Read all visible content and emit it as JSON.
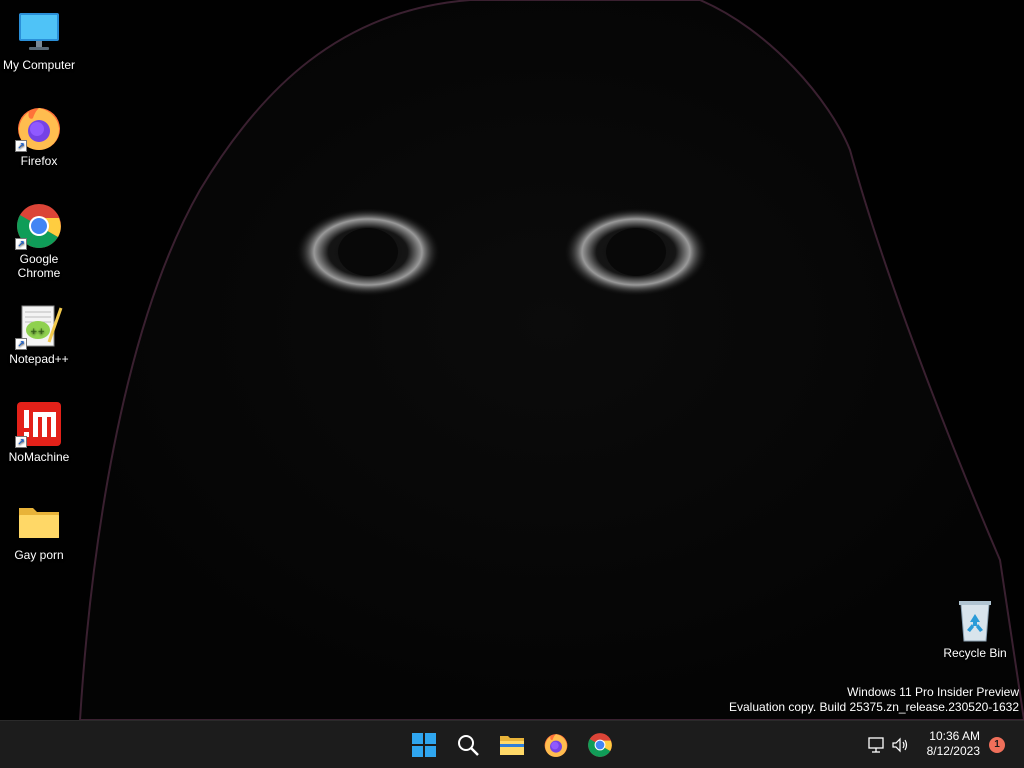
{
  "desktop": {
    "icons": [
      {
        "label": "My Computer",
        "icon": "monitor-icon"
      },
      {
        "label": "Firefox",
        "icon": "firefox-icon"
      },
      {
        "label": "Google Chrome",
        "icon": "chrome-icon"
      },
      {
        "label": "Notepad++",
        "icon": "notepad-plus-plus-icon"
      },
      {
        "label": "NoMachine",
        "icon": "nomachine-icon"
      },
      {
        "label": "Gay porn",
        "icon": "folder-icon"
      }
    ],
    "recycle_bin": {
      "label": "Recycle Bin",
      "icon": "recycle-bin-icon"
    }
  },
  "watermark": {
    "line1": "Windows 11 Pro Insider Preview",
    "line2": "Evaluation copy. Build 25375.zn_release.230520-1632"
  },
  "taskbar": {
    "pinned": [
      {
        "name": "start",
        "icon": "windows-start-icon"
      },
      {
        "name": "search",
        "icon": "search-icon"
      },
      {
        "name": "file-explorer",
        "icon": "folder-icon"
      },
      {
        "name": "firefox",
        "icon": "firefox-icon"
      },
      {
        "name": "chrome",
        "icon": "chrome-icon"
      }
    ],
    "tray": {
      "network_icon": "network-icon",
      "volume_icon": "speaker-icon",
      "time": "10:36 AM",
      "date": "8/12/2023",
      "notification_count": "1"
    }
  },
  "colors": {
    "taskbar_bg": "#1c1c1c",
    "accent_blue": "#0078d4",
    "notification_badge": "#ef6f5a"
  }
}
